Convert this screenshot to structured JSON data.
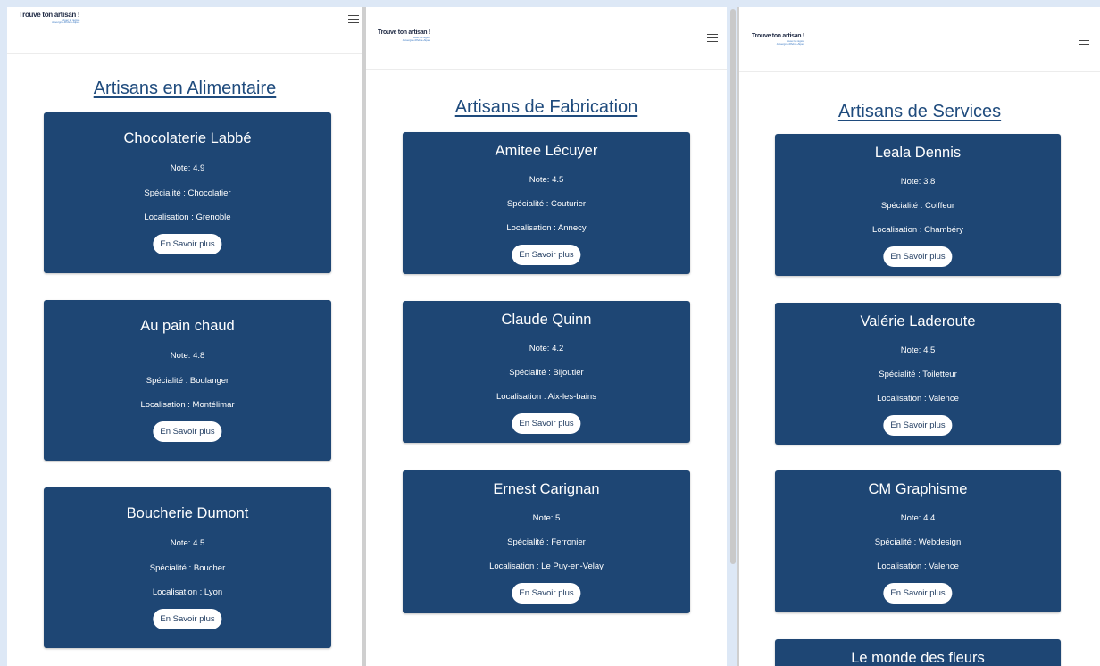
{
  "header": {
    "brand": "Trouve ton artisan !",
    "tagline_1": "Avec la région",
    "tagline_2": "Auvergne-Rhône-Alpes",
    "menu_icon": "hamburger-menu-icon"
  },
  "panels": [
    {
      "title": "Artisans en Alimentaire",
      "cards": [
        {
          "name": "Chocolaterie Labbé",
          "note": "Note: 4.9",
          "specialite": "Spécialité : Chocolatier",
          "localisation": "Localisation : Grenoble",
          "button": "En Savoir plus"
        },
        {
          "name": "Au pain chaud",
          "note": "Note: 4.8",
          "specialite": "Spécialité : Boulanger",
          "localisation": "Localisation : Montélimar",
          "button": "En Savoir plus"
        },
        {
          "name": "Boucherie Dumont",
          "note": "Note: 4.5",
          "specialite": "Spécialité : Boucher",
          "localisation": "Localisation : Lyon",
          "button": "En Savoir plus"
        }
      ]
    },
    {
      "title": "Artisans de Fabrication",
      "cards": [
        {
          "name": "Amitee Lécuyer",
          "note": "Note: 4.5",
          "specialite": "Spécialité : Couturier",
          "localisation": "Localisation : Annecy",
          "button": "En Savoir plus"
        },
        {
          "name": "Claude Quinn",
          "note": "Note: 4.2",
          "specialite": "Spécialité : Bijoutier",
          "localisation": "Localisation : Aix-les-bains",
          "button": "En Savoir plus"
        },
        {
          "name": "Ernest Carignan",
          "note": "Note: 5",
          "specialite": "Spécialité : Ferronier",
          "localisation": "Localisation : Le Puy-en-Velay",
          "button": "En Savoir plus"
        }
      ]
    },
    {
      "title": "Artisans de Services",
      "cards": [
        {
          "name": "Leala Dennis",
          "note": "Note: 3.8",
          "specialite": "Spécialité : Coiffeur",
          "localisation": "Localisation : Chambéry",
          "button": "En Savoir plus"
        },
        {
          "name": "Valérie Laderoute",
          "note": "Note: 4.5",
          "specialite": "Spécialité : Toiletteur",
          "localisation": "Localisation : Valence",
          "button": "En Savoir plus"
        },
        {
          "name": "CM Graphisme",
          "note": "Note: 4.4",
          "specialite": "Spécialité : Webdesign",
          "localisation": "Localisation : Valence",
          "button": "En Savoir plus"
        },
        {
          "name": "Le monde des fleurs",
          "note": "",
          "specialite": "",
          "localisation": "",
          "button": ""
        }
      ]
    }
  ],
  "colors": {
    "card_bg": "#1e4674",
    "title": "#1f4b7d",
    "page_bg": "#dde8f6"
  }
}
